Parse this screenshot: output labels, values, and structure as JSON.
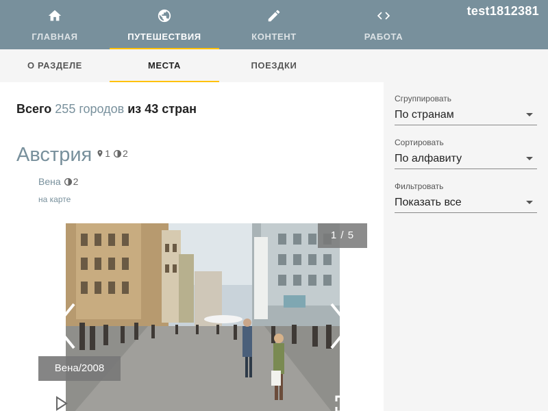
{
  "user": {
    "name": "test1812381"
  },
  "nav": {
    "tabs": [
      {
        "label": "ГЛАВНАЯ",
        "icon": "home-icon"
      },
      {
        "label": "ПУТЕШЕСТВИЯ",
        "icon": "globe-icon"
      },
      {
        "label": "КОНТЕНТ",
        "icon": "pencil-icon"
      },
      {
        "label": "РАБОТА",
        "icon": "code-icon"
      }
    ],
    "active_index": 1
  },
  "subnav": {
    "tabs": [
      {
        "label": "О РАЗДЕЛЕ"
      },
      {
        "label": "МЕСТА"
      },
      {
        "label": "ПОЕЗДКИ"
      }
    ],
    "active_index": 1
  },
  "summary": {
    "prefix": "Всего",
    "cities": "255 городов",
    "suffix": "из 43 стран"
  },
  "country": {
    "name": "Австрия",
    "places_count": "1",
    "visits_count": "2"
  },
  "city": {
    "name": "Вена",
    "visits_count": "2",
    "map_link": "на карте"
  },
  "slider": {
    "counter": "1 / 5",
    "caption": "Вена/2008"
  },
  "filters": {
    "group": {
      "label": "Сгруппировать",
      "value": "По странам"
    },
    "sort": {
      "label": "Сортировать",
      "value": "По алфавиту"
    },
    "filter": {
      "label": "Фильтровать",
      "value": "Показать все"
    }
  },
  "colors": {
    "appbar": "#78909c",
    "accent": "#ffc107",
    "link": "#78909c"
  }
}
